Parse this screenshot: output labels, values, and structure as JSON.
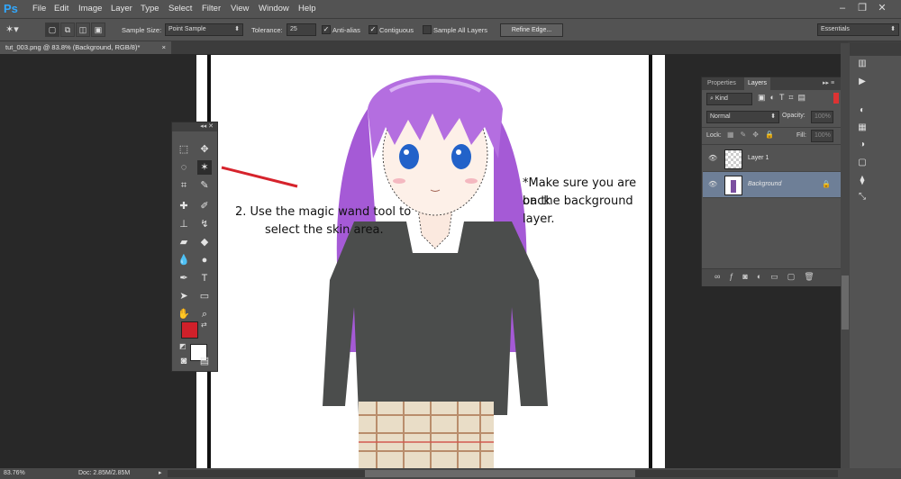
{
  "app": {
    "logo": "Ps"
  },
  "menu": [
    "File",
    "Edit",
    "Image",
    "Layer",
    "Type",
    "Select",
    "Filter",
    "View",
    "Window",
    "Help"
  ],
  "window_controls": {
    "minimize": "–",
    "restore": "❐",
    "close": "✕"
  },
  "options": {
    "sample_size_label": "Sample Size:",
    "sample_size_value": "Point Sample",
    "tolerance_label": "Tolerance:",
    "tolerance_value": "25",
    "antialias_label": "Anti-alias",
    "contiguous_label": "Contiguous",
    "sample_all_label": "Sample All Layers",
    "refine_edge_label": "Refine Edge...",
    "workspace_value": "Essentials"
  },
  "document": {
    "tab_title": "tut_003.png @ 83.8% (Background, RGB/8)*",
    "close": "×"
  },
  "annotations": {
    "instruction_line1": "2. Use the magic wand tool to",
    "instruction_line2": "select the skin area.",
    "note_line1": "*Make sure you are back",
    "note_line2": "on the background layer."
  },
  "layers_panel": {
    "tab_properties": "Properties",
    "tab_layers": "Layers",
    "filter_kind": "Kind",
    "blend_mode": "Normal",
    "opacity_label": "Opacity:",
    "opacity_value": "100%",
    "lock_label": "Lock:",
    "fill_label": "Fill:",
    "fill_value": "100%",
    "layers": [
      {
        "name": "Layer 1"
      },
      {
        "name": "Background"
      }
    ]
  },
  "status": {
    "zoom": "83.76%",
    "doc_info": "Doc: 2.85M/2.85M"
  },
  "colors": {
    "foreground": "#d0202a",
    "background": "#ffffff",
    "hair": "#b46ee0",
    "sweater": "#4b4d4c",
    "selected_layer": "#6e7f97",
    "annotation_line": "#d6232c"
  }
}
